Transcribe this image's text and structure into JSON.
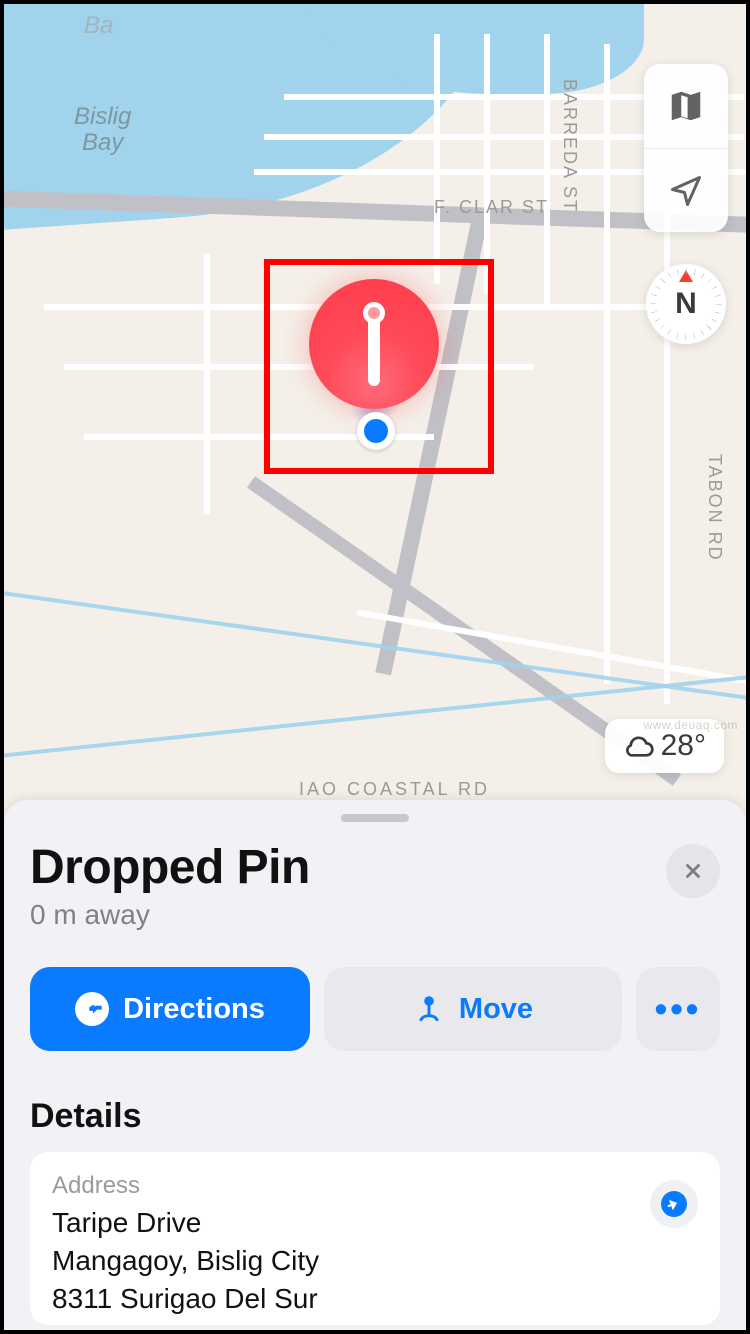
{
  "map": {
    "area_label": "Ba",
    "bay_label_line1": "Bislig",
    "bay_label_line2": "Bay",
    "streets": {
      "barreda": "BARREDA ST",
      "fclar": "F. CLAR ST",
      "tabon": "TABON RD",
      "coastal": "IAO COASTAL RD"
    },
    "compass_label": "N",
    "weather_temp": "28°"
  },
  "sheet": {
    "title": "Dropped Pin",
    "distance": "0 m away",
    "directions_label": "Directions",
    "move_label": "Move",
    "details_heading": "Details",
    "address_label": "Address",
    "address_line1": "Taripe Drive",
    "address_line2": "Mangagoy, Bislig City",
    "address_line3": "8311 Surigao Del Sur"
  },
  "icons": {
    "map_mode": "map-mode",
    "locate": "location-arrow",
    "cloud": "cloud",
    "close": "close",
    "directions": "turn-arrow",
    "move_pin": "pin-move",
    "more": "ellipsis",
    "share": "share-arrow"
  },
  "colors": {
    "accent": "#0a7bff",
    "pin": "#ff4a59",
    "water": "#a1d3ec",
    "land": "#f4f0e9",
    "sheet_bg": "#f2f2f6"
  },
  "watermark": "www.deuaq.com"
}
